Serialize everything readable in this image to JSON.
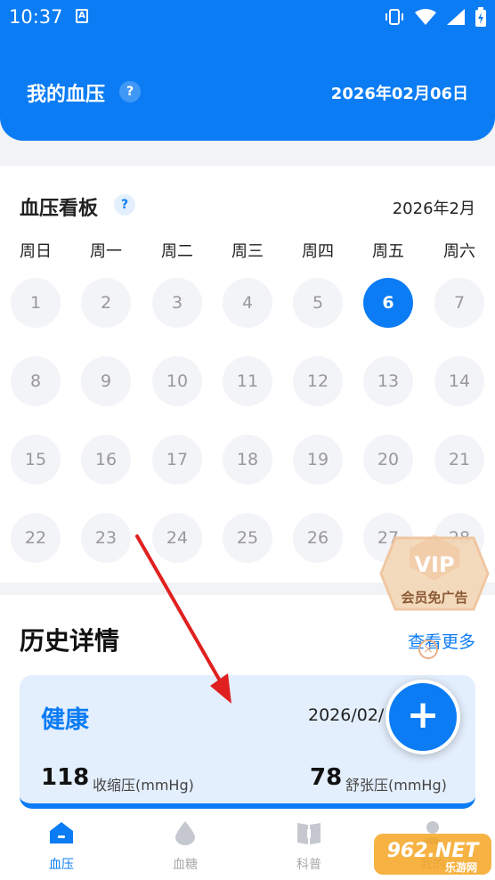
{
  "status_bar": {
    "time": "10:37",
    "a_icon": "A"
  },
  "header": {
    "title": "我的血压",
    "help": "?",
    "date": "2026年02月06日"
  },
  "calendar": {
    "title": "血压看板",
    "help": "?",
    "month": "2026年2月",
    "weekdays": [
      "周日",
      "周一",
      "周二",
      "周三",
      "周四",
      "周五",
      "周六"
    ],
    "days": [
      "1",
      "2",
      "3",
      "4",
      "5",
      "6",
      "7",
      "8",
      "9",
      "10",
      "11",
      "12",
      "13",
      "14",
      "15",
      "16",
      "17",
      "18",
      "19",
      "20",
      "21",
      "22",
      "23",
      "24",
      "25",
      "26",
      "27",
      "28"
    ],
    "selected_day": "6"
  },
  "history": {
    "title": "历史详情",
    "more": "查看更多",
    "record": {
      "status": "健康",
      "date": "2026/02/",
      "systolic": "118",
      "systolic_label": "收缩压(mmHg)",
      "diastolic": "78",
      "diastolic_label": "舒张压(mmHg)"
    }
  },
  "fab": {
    "label": "+"
  },
  "vip": {
    "title": "VIP",
    "subtitle": "会员免广告",
    "close": "×"
  },
  "nav": [
    {
      "label": "血压",
      "icon": "house-icon",
      "active": true
    },
    {
      "label": "血糖",
      "icon": "drop-icon",
      "active": false
    },
    {
      "label": "科普",
      "icon": "book-icon",
      "active": false
    },
    {
      "label": "我的",
      "icon": "person-icon",
      "active": false
    }
  ],
  "watermark": {
    "text": "962.NET",
    "subtext": "乐游网"
  },
  "colors": {
    "primary": "#0b7cf4",
    "arrow": "#e02020"
  }
}
